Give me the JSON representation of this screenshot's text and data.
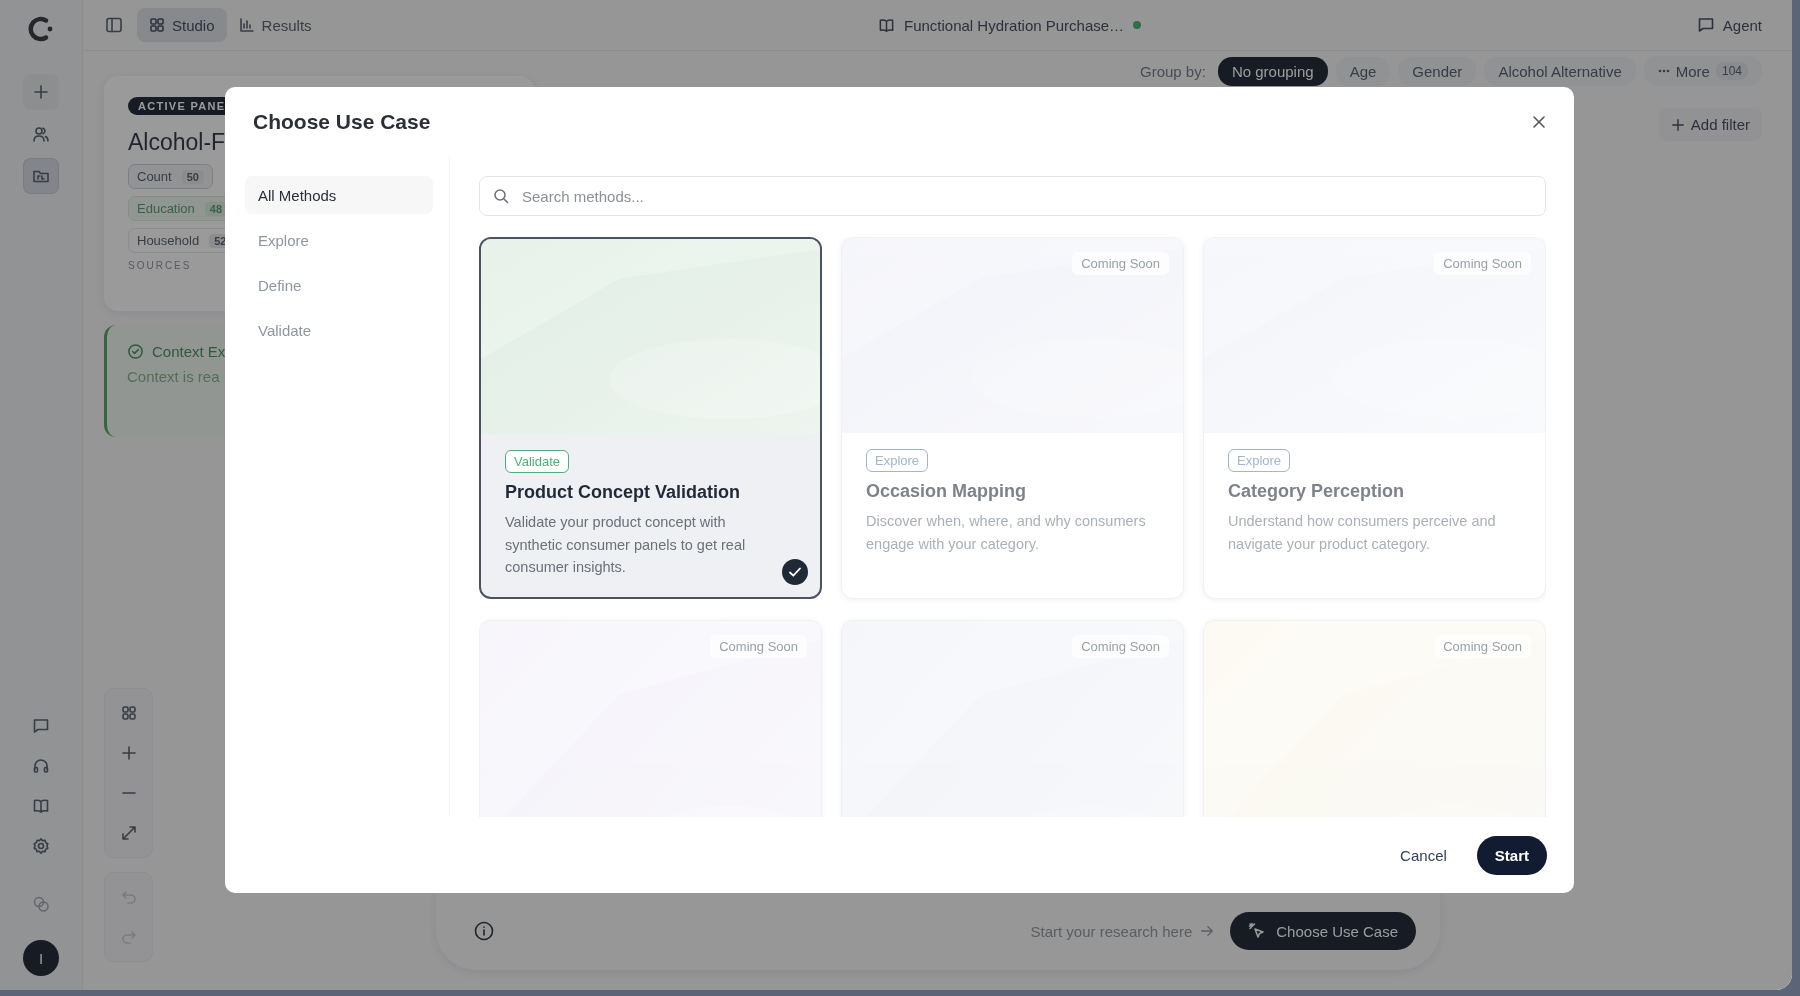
{
  "rail": {
    "items": [
      {
        "kind": "new",
        "selected": false
      },
      {
        "kind": "people",
        "selected": false
      },
      {
        "kind": "folder",
        "selected": true
      }
    ],
    "avatar": "I"
  },
  "topbar": {
    "tabs": [
      {
        "label": "Studio",
        "selected": true
      },
      {
        "label": "Results",
        "selected": false
      }
    ],
    "document_title": "Functional Hydration Purchase…",
    "agent_button": "Agent"
  },
  "group_by": {
    "label": "Group by:",
    "options": [
      {
        "label": "No grouping",
        "selected": true
      },
      {
        "label": "Age",
        "selected": false
      },
      {
        "label": "Gender",
        "selected": false
      },
      {
        "label": "Alcohol Alternative",
        "selected": false
      }
    ],
    "more": {
      "label": "More",
      "count": "104"
    }
  },
  "add_filter": "Add filter",
  "panel_card": {
    "badge": "ACTIVE PANE",
    "title": "Alcohol-F",
    "stats": [
      {
        "kind": "total",
        "label": "Count",
        "value": "50"
      },
      {
        "kind": "match",
        "label": "Education",
        "value": "48"
      },
      {
        "kind": "plain",
        "label": "Household",
        "value": "52"
      }
    ],
    "sources_label": "SOURCES"
  },
  "context": {
    "title": "Context Ex",
    "text": "Context is rea"
  },
  "prompt": {
    "hint": "Start your research here",
    "button": "Choose Use Case"
  },
  "modal": {
    "title": "Choose Use Case",
    "categories": [
      {
        "label": "All Methods",
        "selected": true
      },
      {
        "label": "Explore",
        "selected": false
      },
      {
        "label": "Define",
        "selected": false
      },
      {
        "label": "Validate",
        "selected": false
      }
    ],
    "search": {
      "placeholder": "Search methods..."
    },
    "cards": [
      {
        "tag": {
          "label": "Validate",
          "color": "#4caf78"
        },
        "title": "Product Concept Validation",
        "description": "Validate your product concept with synthetic consumer panels to get real consumer insights.",
        "selected": true,
        "disabled": false
      },
      {
        "badge": "Coming Soon",
        "tag": {
          "label": "Explore",
          "color": "#9fb6cc"
        },
        "title": "Occasion Mapping",
        "description": "Discover when, where, and why consumers engage with your category.",
        "selected": false,
        "disabled": true
      },
      {
        "badge": "Coming Soon",
        "tag": {
          "label": "Explore",
          "color": "#9fb6cc"
        },
        "title": "Category Perception",
        "description": "Understand how consumers perceive and navigate your product category.",
        "selected": false,
        "disabled": true
      },
      {
        "badge": "Coming Soon",
        "selected": false,
        "disabled": true
      },
      {
        "badge": "Coming Soon",
        "selected": false,
        "disabled": true
      },
      {
        "badge": "Coming Soon",
        "selected": false,
        "disabled": true
      }
    ],
    "cancel_button": "Cancel",
    "start_button": "Start"
  }
}
